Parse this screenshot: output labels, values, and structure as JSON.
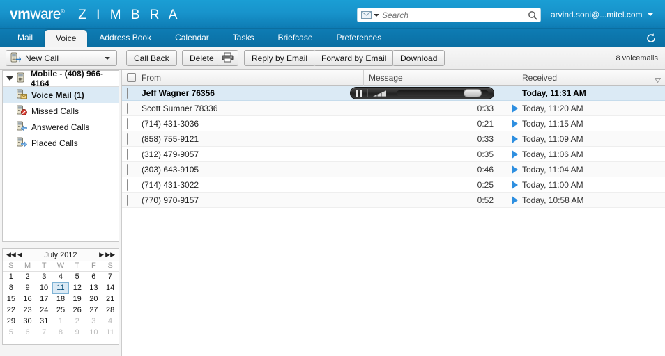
{
  "brand": {
    "vm": "vm",
    "ware": "ware",
    "tm": "®",
    "product": "Z I M B R A"
  },
  "search": {
    "placeholder": "Search",
    "value": "",
    "type_icon": "envelope-icon",
    "go_icon": "magnifier-icon"
  },
  "account": {
    "name": "arvind.soni@...mitel.com"
  },
  "tabs": [
    {
      "label": "Mail",
      "active": false
    },
    {
      "label": "Voice",
      "active": true
    },
    {
      "label": "Address Book",
      "active": false
    },
    {
      "label": "Calendar",
      "active": false
    },
    {
      "label": "Tasks",
      "active": false
    },
    {
      "label": "Briefcase",
      "active": false
    },
    {
      "label": "Preferences",
      "active": false
    }
  ],
  "refresh_icon": "refresh-icon",
  "toolbar": {
    "new_call": "New Call",
    "call_back": "Call Back",
    "delete": "Delete",
    "print_icon": "printer-icon",
    "reply_by_email": "Reply by Email",
    "forward_by_email": "Forward by Email",
    "download": "Download",
    "count": "8 voicemails"
  },
  "sidebar": {
    "root": {
      "label": "Mobile - (408) 966-4164",
      "icon": "phone-icon"
    },
    "items": [
      {
        "label": "Voice Mail (1)",
        "icon": "voicemail-icon",
        "selected": true
      },
      {
        "label": "Missed Calls",
        "icon": "missed-call-icon",
        "selected": false
      },
      {
        "label": "Answered Calls",
        "icon": "answered-call-icon",
        "selected": false
      },
      {
        "label": "Placed Calls",
        "icon": "placed-call-icon",
        "selected": false
      }
    ]
  },
  "calendar": {
    "title": "July 2012",
    "nav": {
      "prev_year": "◀◀",
      "prev_month": "◀",
      "next_month": "▶",
      "next_year": "▶▶"
    },
    "daynames": [
      "S",
      "M",
      "T",
      "W",
      "T",
      "F",
      "S"
    ],
    "weeks": [
      [
        {
          "d": "1"
        },
        {
          "d": "2"
        },
        {
          "d": "3"
        },
        {
          "d": "4"
        },
        {
          "d": "5"
        },
        {
          "d": "6"
        },
        {
          "d": "7"
        }
      ],
      [
        {
          "d": "8"
        },
        {
          "d": "9"
        },
        {
          "d": "10"
        },
        {
          "d": "11",
          "today": true
        },
        {
          "d": "12"
        },
        {
          "d": "13"
        },
        {
          "d": "14"
        }
      ],
      [
        {
          "d": "15"
        },
        {
          "d": "16"
        },
        {
          "d": "17"
        },
        {
          "d": "18"
        },
        {
          "d": "19"
        },
        {
          "d": "20"
        },
        {
          "d": "21"
        }
      ],
      [
        {
          "d": "22"
        },
        {
          "d": "23"
        },
        {
          "d": "24"
        },
        {
          "d": "25"
        },
        {
          "d": "26"
        },
        {
          "d": "27"
        },
        {
          "d": "28"
        }
      ],
      [
        {
          "d": "29"
        },
        {
          "d": "30"
        },
        {
          "d": "31"
        },
        {
          "d": "1",
          "other": true
        },
        {
          "d": "2",
          "other": true
        },
        {
          "d": "3",
          "other": true
        },
        {
          "d": "4",
          "other": true
        }
      ],
      [
        {
          "d": "5",
          "other": true
        },
        {
          "d": "6",
          "other": true
        },
        {
          "d": "7",
          "other": true
        },
        {
          "d": "8",
          "other": true
        },
        {
          "d": "9",
          "other": true
        },
        {
          "d": "10",
          "other": true
        },
        {
          "d": "11",
          "other": true
        }
      ]
    ]
  },
  "list": {
    "columns": [
      "From",
      "Message",
      "Received"
    ],
    "sort_icon": "sort-descending-icon",
    "rows": [
      {
        "from": "Jeff Wagner  76356",
        "duration": "",
        "received": "Today, 11:31 AM",
        "selected": true,
        "playing": true
      },
      {
        "from": "Scott Sumner  78336",
        "duration": "0:33",
        "received": "Today, 11:20 AM",
        "selected": false,
        "playing": false
      },
      {
        "from": "(714) 431-3036",
        "duration": "0:21",
        "received": "Today, 11:15 AM",
        "selected": false,
        "playing": false
      },
      {
        "from": "(858) 755-9121",
        "duration": "0:33",
        "received": "Today, 11:09 AM",
        "selected": false,
        "playing": false
      },
      {
        "from": "(312) 479-9057",
        "duration": "0:35",
        "received": "Today, 11:06 AM",
        "selected": false,
        "playing": false
      },
      {
        "from": "(303) 643-9105",
        "duration": "0:46",
        "received": "Today, 11:04 AM",
        "selected": false,
        "playing": false
      },
      {
        "from": "(714) 431-3022",
        "duration": "0:25",
        "received": "Today, 11:00 AM",
        "selected": false,
        "playing": false
      },
      {
        "from": "(770) 970-9157",
        "duration": "0:52",
        "received": "Today, 10:58 AM",
        "selected": false,
        "playing": false
      }
    ]
  },
  "colors": {
    "brand_blue": "#1894cc",
    "tab_blue": "#0e7cb4",
    "selection": "#dbeaf5",
    "play_blue": "#2e8fe0"
  }
}
